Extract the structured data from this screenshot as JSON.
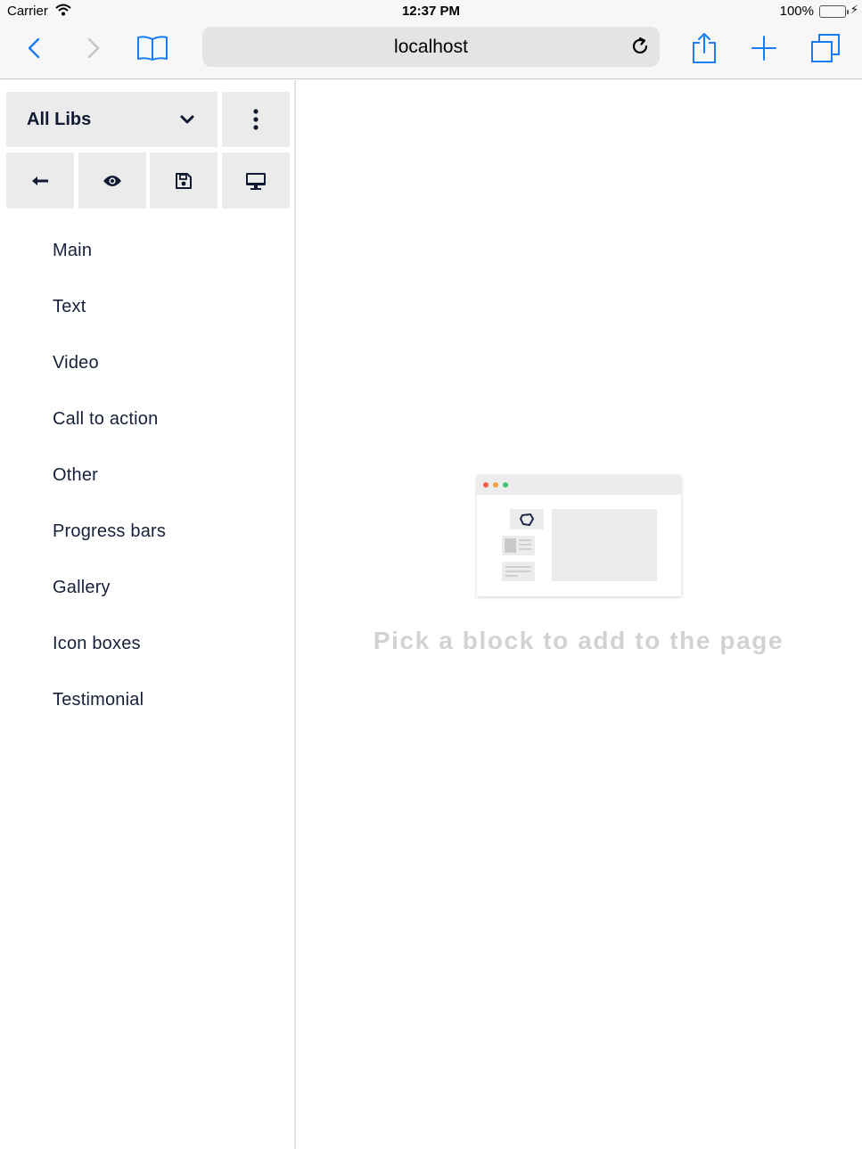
{
  "status_bar": {
    "carrier": "Carrier",
    "time": "12:37 PM",
    "battery_percent": "100%",
    "battery_level": 1.0,
    "battery_color": "#4cd964",
    "wifi_icon": "wifi-icon",
    "charging_icon": "bolt-icon"
  },
  "browser": {
    "url": "localhost",
    "accent_color": "#1a7cf6",
    "icons": {
      "back": "chevron-left-icon",
      "forward": "chevron-right-icon",
      "bookmarks": "book-icon",
      "reload": "reload-icon",
      "share": "share-icon",
      "new_tab": "plus-icon",
      "tabs": "tabs-icon"
    }
  },
  "sidebar": {
    "library_select": {
      "label": "All Libs",
      "icon": "chevron-down-icon"
    },
    "menu_icon": "kebab-menu-icon",
    "tools": [
      {
        "name": "back",
        "icon": "arrow-left-icon"
      },
      {
        "name": "preview",
        "icon": "eye-icon"
      },
      {
        "name": "save",
        "icon": "floppy-disk-icon"
      },
      {
        "name": "desktop-view",
        "icon": "desktop-icon"
      }
    ],
    "categories": [
      "Main",
      "Text",
      "Video",
      "Call to action",
      "Other",
      "Progress bars",
      "Gallery",
      "Icon boxes",
      "Testimonial"
    ]
  },
  "main": {
    "empty_message": "Pick a block to add to the page",
    "illustration_dot_colors": [
      "#ee5e4f",
      "#f2a33b",
      "#3fc571"
    ]
  }
}
